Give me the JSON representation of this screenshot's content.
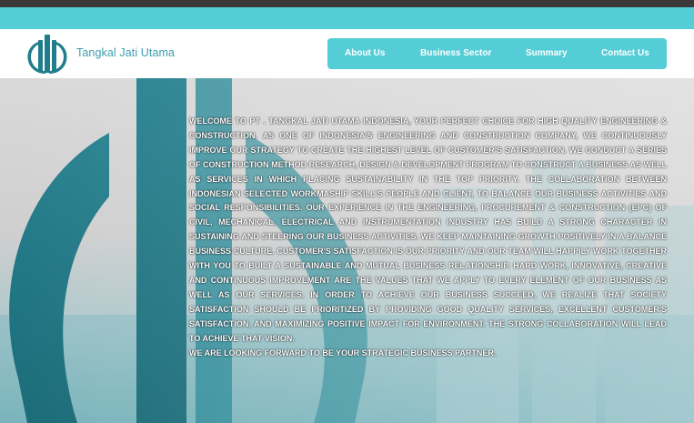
{
  "brand": {
    "name": "Tangkal Jati Utama",
    "logo_icon": "tangkal-jati-logo-icon",
    "color": "#3f9db0"
  },
  "nav": {
    "items": [
      {
        "label": "About Us"
      },
      {
        "label": "Business Sector"
      },
      {
        "label": "Summary"
      },
      {
        "label": "Contact Us"
      }
    ],
    "background": "#55cdd6"
  },
  "hero": {
    "paragraph": "WELCOME TO PT . TANGKAL JATI UTAMA INDONESIA, YOUR PERFECT CHOICE FOR HIGH QUALITY ENGINEERING & CONSTRUCTION. AS ONE OF INDONESIA'S ENGINEERING AND CONSTRUCTION COMPANY, WE CONTINUOUSLY IMPROVE OUR STRATEGY TO CREATE THE HIGHEST LEVEL OF CUSTOMER'S SATISFACTION. WE CONDUCT A SERIES OF CONSTRUCTION METHOD RESEARCH, DESIGN & DEVELOPMENT PROGRAM TO CONSTRUCT A BUSINESS AS WELL AS SERVICES IN WHICH PLACING SUSTAINABILITY IN THE TOP PRIORITY. THE COLLABORATION BETWEEN INDONESIAN SELECTED WORKMASHIP SKILL'S PEOPLE AND CLIENT, TO BALANCE OUR BUSINESS ACTIVITIES AND SOCIAL RESPONSIBILITIES. OUR EXPERIENCE IN THE ENGINEERING, PROCUREMENT & CONSTRUCTION (EPC) OF CIVIL, MECHANICAL, ELECTRICAL AND INSTRUMENTATION INDUSTRY HAS BUILD A STRONG CHARACTER IN SUSTAINING AND STEERING OUR BUSINESS ACTIVITIES. WE KEEP MAINTAINING GROWTH POSITIVELY IN A BALANCE BUSINESS CULTURE. CUSTOMER'S SATISFACTION IS OUR PRIORITY AND OUR TEAM WILL HAPPILY WORK TOGETHER WITH YOU TO BUILT A SUSTAINABLE AND MUTUAL BUSINESS RELATIONSHIP. HARD WORK, INNOVATIVE, CREATIVE AND CONTINUOUS IMPROVEMENT ARE THE VALUES THAT WE APPLY TO EVERY ELEMENT OF OUR BUSINESS AS WELL AS OUR SERVICES. IN ORDER TO ACHIEVE OUR BUSINESS SUCCEED, WE REALIZE THAT SOCIETY SATISFACTION SHOULD BE PRIORITIZED BY PROVIDING GOOD QUALITY SERVICES, EXCELLENT CUSTOMER'S SATISFACTION, AND MAXIMIZING POSITIVE IMPACT FOR ENVIRONMENT. THE STRONG COLLABORATION WILL LEAD TO ACHIEVE THAT VISION.",
    "closing": "WE ARE LOOKING FORWARD TO BE YOUR STRATEGIC BUSINESS PARTNER."
  },
  "colors": {
    "top_bar": "#3a3a3a",
    "accent_bar": "#55cdd6",
    "logo_teal": "#1f7d8c"
  }
}
